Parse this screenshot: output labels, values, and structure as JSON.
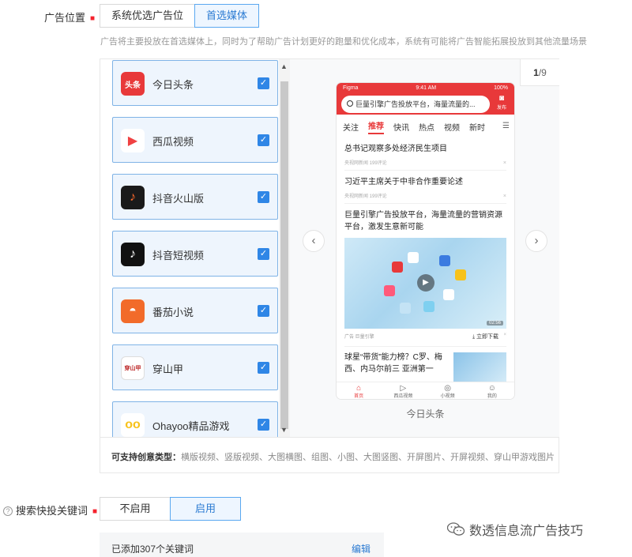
{
  "ad_position": {
    "label": "广告位置",
    "options": [
      "系统优选广告位",
      "首选媒体"
    ],
    "selected": "首选媒体",
    "hint": "广告将主要投放在首选媒体上，同时为了帮助广告计划更好的跑量和优化成本，系统有可能将广告智能拓展投放到其他流量场景"
  },
  "media_list": [
    {
      "name": "今日头条",
      "icon": "toutiao-logo-icon",
      "logo_text": "头条",
      "color": "#e8393a",
      "checked": true
    },
    {
      "name": "西瓜视频",
      "icon": "xigua-logo-icon",
      "logo_text": "▶",
      "color": "#f04142",
      "checked": true
    },
    {
      "name": "抖音火山版",
      "icon": "douyin-huoshan-logo-icon",
      "logo_text": "♪",
      "color": "#1a1a1a",
      "checked": true
    },
    {
      "name": "抖音短视频",
      "icon": "douyin-logo-icon",
      "logo_text": "♪",
      "color": "#111111",
      "checked": true
    },
    {
      "name": "番茄小说",
      "icon": "fanqie-logo-icon",
      "logo_text": "◓",
      "color": "#f26b2a",
      "checked": true
    },
    {
      "name": "穿山甲",
      "icon": "pangle-logo-icon",
      "logo_text": "穿山甲",
      "color": "#ffffff",
      "checked": true
    },
    {
      "name": "Ohayoo精品游戏",
      "icon": "ohayoo-logo-icon",
      "logo_text": "oo",
      "color": "#f7c21b",
      "checked": true
    }
  ],
  "preview": {
    "page_current": "1",
    "page_total": "/9",
    "caption": "今日头条",
    "phone": {
      "carrier": "Figma",
      "time": "9:41 AM",
      "battery": "100%",
      "search_text": "巨量引擎广告投放平台，海量流量的...",
      "camera_label": "发布",
      "tabs": [
        "关注",
        "推荐",
        "快讯",
        "热点",
        "视频",
        "新时"
      ],
      "active_tab": "推荐",
      "news": [
        {
          "title": "总书记观察多处经济民生项目",
          "meta": "央视网新闻  199评论"
        },
        {
          "title": "习近平主席关于中非合作重要论述",
          "meta": "央视网新闻  199评论"
        }
      ],
      "ad": {
        "title": "巨量引擎广告投放平台，海量流量的营销资源平台，激发生意新可能",
        "duration": "02:56",
        "meta": "广告  巨量引擎",
        "download": "立即下载"
      },
      "news4_title": "球星“带货”能力榜？C罗、梅西、内马尔前三 亚洲第一",
      "bottom_nav": [
        "首页",
        "西瓜视频",
        "小视频",
        "我的"
      ]
    }
  },
  "support": {
    "label": "可支持创意类型：",
    "types": "横版视频、竖版视频、大图横图、组图、小图、大图竖图、开屏图片、开屏视频、穿山甲游戏图片"
  },
  "keyword": {
    "label": "搜索快投关键词",
    "options": [
      "不启用",
      "启用"
    ],
    "selected": "启用",
    "added_text": "已添加307个关键词",
    "edit_label": "编辑"
  },
  "watermark": "数透信息流广告技巧",
  "colors": {
    "accent": "#2f86e6",
    "toutiao_red": "#e8393a",
    "required": "#f5222d"
  }
}
